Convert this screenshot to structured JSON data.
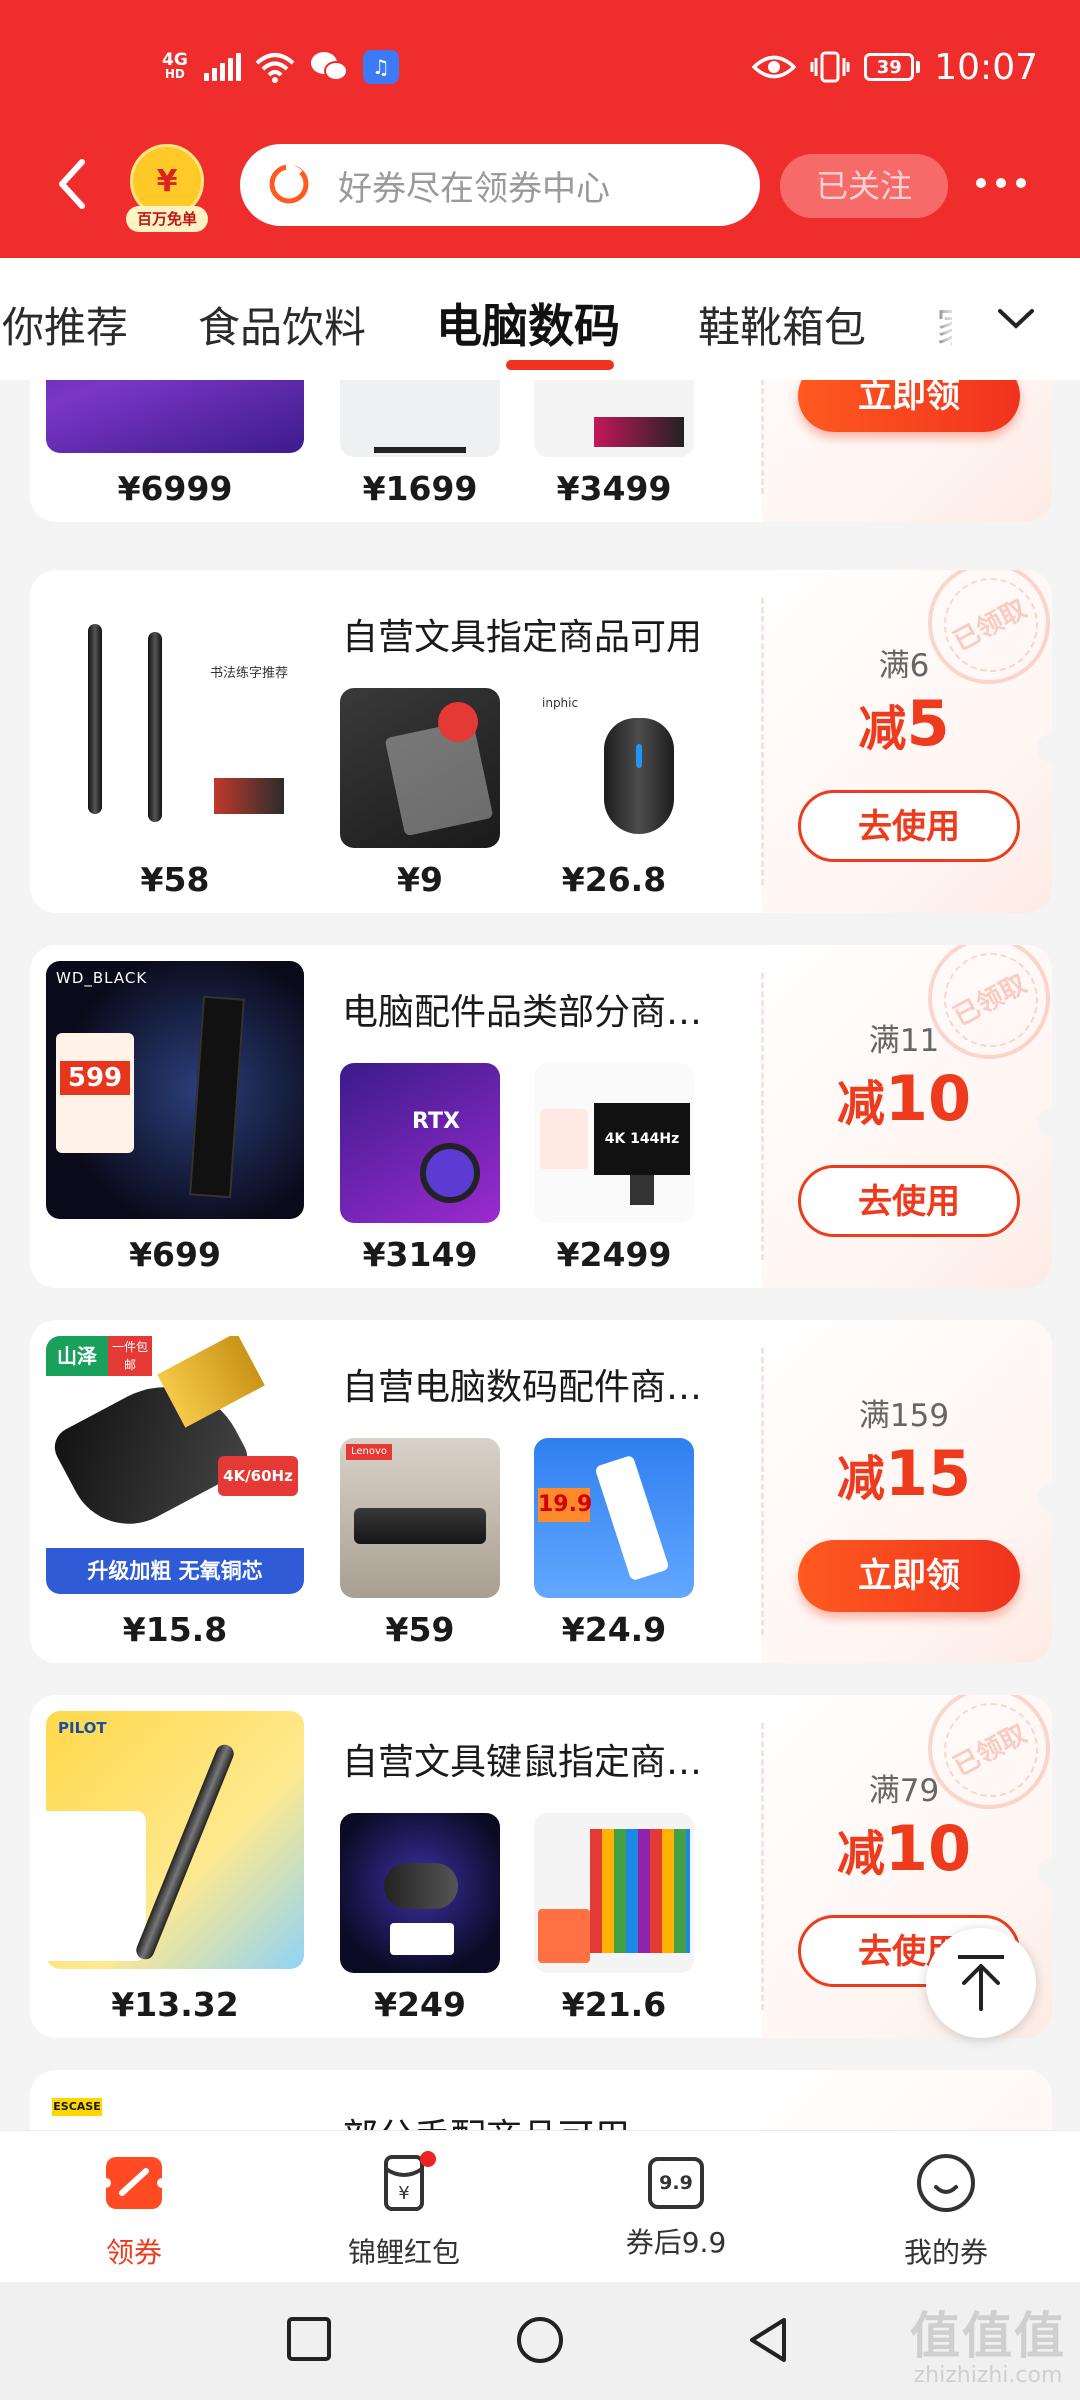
{
  "status_bar": {
    "network": "4G",
    "network_sub": "HD",
    "battery": "39",
    "time": "10:07"
  },
  "header": {
    "logo_symbol": "¥",
    "logo_caption": "百万免单",
    "search_placeholder": "好券尽在领券中心",
    "follow_label": "已关注"
  },
  "categories": {
    "items": [
      "你推荐",
      "食品饮料",
      "电脑数码",
      "鞋靴箱包",
      "家"
    ],
    "active": "电脑数码"
  },
  "coupons": [
    {
      "title": "",
      "prices": [
        "¥6999",
        "¥1699",
        "¥3499"
      ],
      "condition": "",
      "discount_prefix": "",
      "discount_amount": "",
      "action": "立即领",
      "claimed": false
    },
    {
      "title": "自营文具指定商品可用",
      "prices": [
        "¥58",
        "¥9",
        "¥26.8"
      ],
      "condition": "满6",
      "discount_prefix": "减",
      "discount_amount": "5",
      "action": "去使用",
      "claimed": true
    },
    {
      "title": "电脑配件品类部分商…",
      "prices": [
        "¥699",
        "¥3149",
        "¥2499"
      ],
      "condition": "满11",
      "discount_prefix": "减",
      "discount_amount": "10",
      "action": "去使用",
      "claimed": true
    },
    {
      "title": "自营电脑数码配件商…",
      "prices": [
        "¥15.8",
        "¥59",
        "¥24.9"
      ],
      "condition": "满159",
      "discount_prefix": "减",
      "discount_amount": "15",
      "action": "立即领",
      "claimed": false
    },
    {
      "title": "自营文具键鼠指定商…",
      "prices": [
        "¥13.32",
        "¥249",
        "¥21.6"
      ],
      "condition": "满79",
      "discount_prefix": "减",
      "discount_amount": "10",
      "action": "去使用",
      "claimed": true
    },
    {
      "title": "部分手配商品可用",
      "prices": [
        "",
        "",
        ""
      ],
      "condition": "",
      "discount_prefix": "",
      "discount_amount": "",
      "action": "",
      "claimed": false
    }
  ],
  "stamp_text": "已领取",
  "thumb_texts": {
    "pen_banner": "书法练字推荐",
    "ssd_brand": "WD_BLACK",
    "ssd_price": "599",
    "hdmi_brand": "山泽",
    "hdmi_badge": "一件包邮",
    "hdmi_spec": "4K/60Hz",
    "hdmi_slogan": "升级加粗 无氧铜芯",
    "pilot_brand": "PILOT",
    "rtx_label": "RTX",
    "monitor_spec": "4K 144Hz",
    "mouse_brand": "inphic",
    "lenovo_brand": "Lenovo",
    "strip_price": "19.9"
  },
  "bottom_nav": [
    {
      "label": "领券",
      "active": true
    },
    {
      "label": "锦鲤红包",
      "active": false
    },
    {
      "label": "券后9.9",
      "active": false,
      "icon_text": "9.9"
    },
    {
      "label": "我的券",
      "active": false
    }
  ],
  "watermark": {
    "logo": "值值值",
    "url": "zhizhizhi.com"
  },
  "colors": {
    "header_red": "#f02d2d",
    "accent": "#ee3a1d",
    "button_gradient": "#ff5a1f"
  }
}
